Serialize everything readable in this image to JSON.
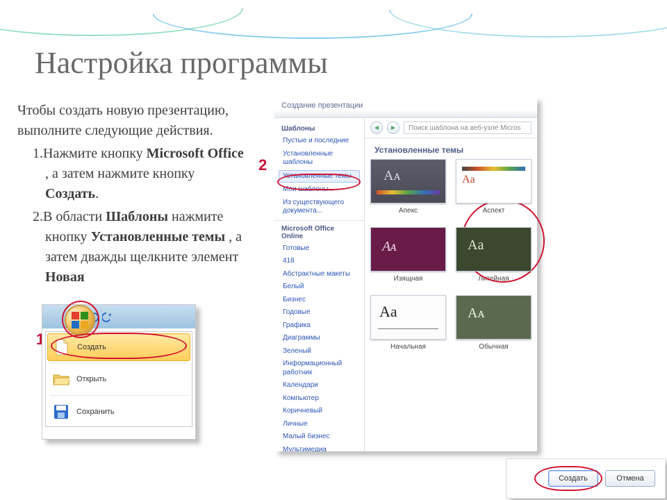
{
  "title": "Настройка программы",
  "body": {
    "lead": "Чтобы создать новую презентацию, выполните следующие действия.",
    "step1_a": "1.Нажмите кнопку ",
    "step1_b": "Microsoft Office",
    "step1_c": " , а затем нажмите кнопку ",
    "step1_d": "Создать",
    "step1_e": ".",
    "step2_a": "2.В области ",
    "step2_b": "Шаблоны",
    "step2_c": " нажмите кнопку ",
    "step2_d": "Установленные темы",
    "step2_e": " , а затем дважды щелкните элемент ",
    "step2_f": "Новая"
  },
  "badges": {
    "one": "1",
    "two": "2"
  },
  "office_menu": {
    "create": "Создать",
    "open": "Открыть",
    "save": "Сохранить"
  },
  "dialog": {
    "title": "Создание презентации",
    "search_placeholder": "Поиск шаблона на веб-узле Micros",
    "panel_header": "Установленные темы",
    "left": {
      "hdr1": "Шаблоны",
      "items1": [
        "Пустые и последние",
        "Установленные шаблоны",
        "Установленные темы",
        "Мои шаблоны...",
        "Из существующего документа..."
      ],
      "hdr2": "Microsoft Office Online",
      "items2": [
        "Готовые",
        "418",
        "Абстрактные макеты",
        "Белый",
        "Бизнес",
        "Годовые",
        "Графика",
        "Диаграммы",
        "Зеленый",
        "Информационный работник",
        "Календари",
        "Компьютер",
        "Коричневый",
        "Личные",
        "Малый бизнес",
        "Мультимедиа"
      ]
    },
    "thumbs": [
      {
        "label": "Апекс",
        "aa": "Aᴀ",
        "cls": "t-apex"
      },
      {
        "label": "Аспект",
        "aa": "Aa",
        "cls": "t-aspect"
      },
      {
        "label": "Изящная",
        "aa": "Aᴀ",
        "cls": "t-elegant"
      },
      {
        "label": "Литейная",
        "aa": "Aa",
        "cls": "t-foundry"
      },
      {
        "label": "Начальная",
        "aa": "Aa",
        "cls": "t-initial"
      },
      {
        "label": "Обычная",
        "aa": "Aᴀ",
        "cls": "t-common"
      }
    ]
  },
  "footer": {
    "create": "Создать",
    "cancel": "Отмена"
  }
}
